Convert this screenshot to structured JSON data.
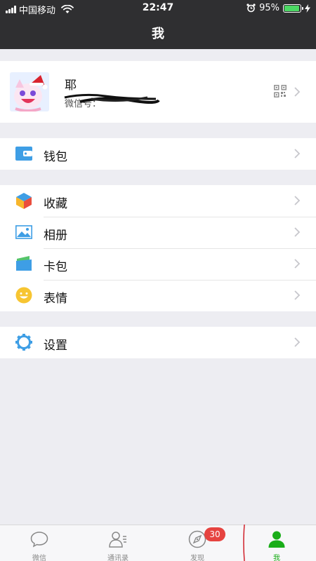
{
  "status_bar": {
    "carrier": "中国移动",
    "time": "22:47",
    "battery": "95%",
    "battery_level": 0.95
  },
  "nav": {
    "title": "我"
  },
  "profile": {
    "nickname": "耶",
    "wechat_id": "微信号：",
    "qr_icon": "qrcode-icon"
  },
  "groups": [
    {
      "items": [
        {
          "label": "钱包",
          "icon": "wallet-icon"
        }
      ]
    },
    {
      "items": [
        {
          "label": "收藏",
          "icon": "favorites-icon"
        },
        {
          "label": "相册",
          "icon": "album-icon"
        },
        {
          "label": "卡包",
          "icon": "card-package-icon"
        },
        {
          "label": "表情",
          "icon": "sticker-icon"
        }
      ]
    },
    {
      "items": [
        {
          "label": "设置",
          "icon": "settings-icon"
        }
      ]
    }
  ],
  "tabbar": {
    "tabs": [
      {
        "label": "微信",
        "icon": "chat-icon"
      },
      {
        "label": "通讯录",
        "icon": "contacts-icon"
      },
      {
        "label": "发现",
        "icon": "discover-icon",
        "badge": "30"
      },
      {
        "label": "我",
        "icon": "me-icon",
        "active": true
      }
    ]
  },
  "colors": {
    "nav_bg": "#2f2f31",
    "accent": "#1aad19",
    "badge": "#e64340",
    "page_bg": "#ededf2"
  }
}
